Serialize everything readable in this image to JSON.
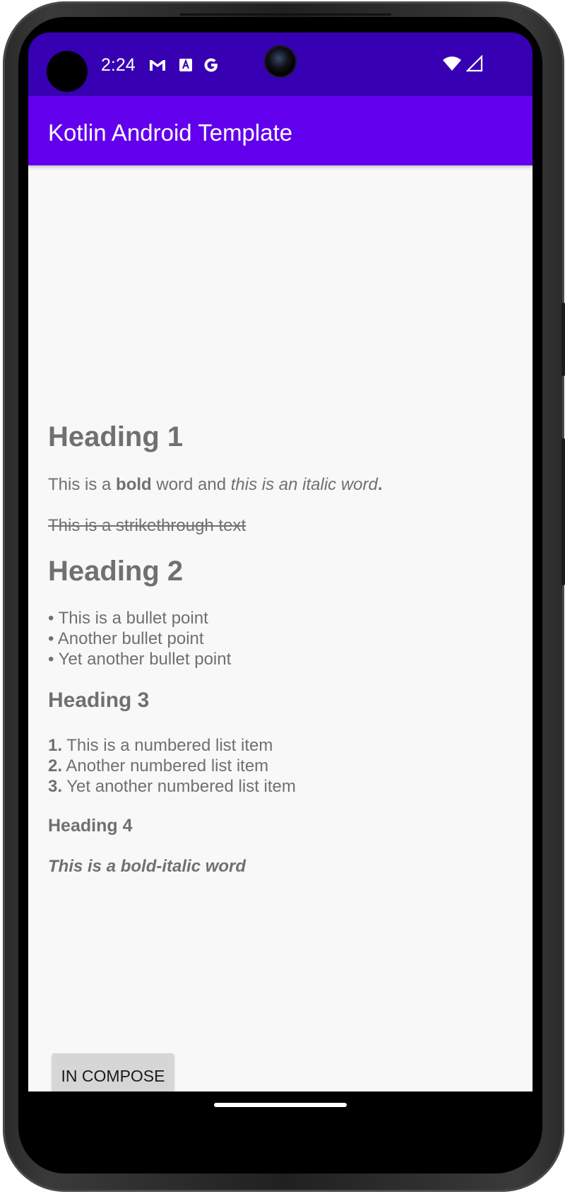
{
  "status_bar": {
    "time": "2:24",
    "notification_icons": [
      "gmail-icon",
      "translate-icon",
      "google-icon"
    ],
    "system_icons": [
      "wifi-icon",
      "cellular-signal-icon"
    ],
    "background_color": "#3700b3"
  },
  "app_bar": {
    "title": "Kotlin Android Template",
    "background_color": "#6200ee"
  },
  "content": {
    "heading_1": "Heading 1",
    "paragraph_1": {
      "part_1": "This is a ",
      "bold": "bold",
      "part_2": " word and ",
      "italic": "this is an italic word",
      "part_3": "."
    },
    "strikethrough_text": "This is a strikethrough text",
    "heading_2": "Heading 2",
    "bullet_items": [
      "• This is a bullet point",
      "• Another bullet point",
      "• Yet another bullet point"
    ],
    "heading_3": "Heading 3",
    "numbered_items": [
      {
        "number": "1.",
        "text": " This is a numbered list item"
      },
      {
        "number": "2.",
        "text": " Another numbered list item"
      },
      {
        "number": "3.",
        "text": " Yet another numbered list item"
      }
    ],
    "heading_4": "Heading 4",
    "bold_italic_text": "This is a bold-italic word",
    "text_color": "#707070"
  },
  "compose_button": {
    "label": "IN COMPOSE"
  }
}
